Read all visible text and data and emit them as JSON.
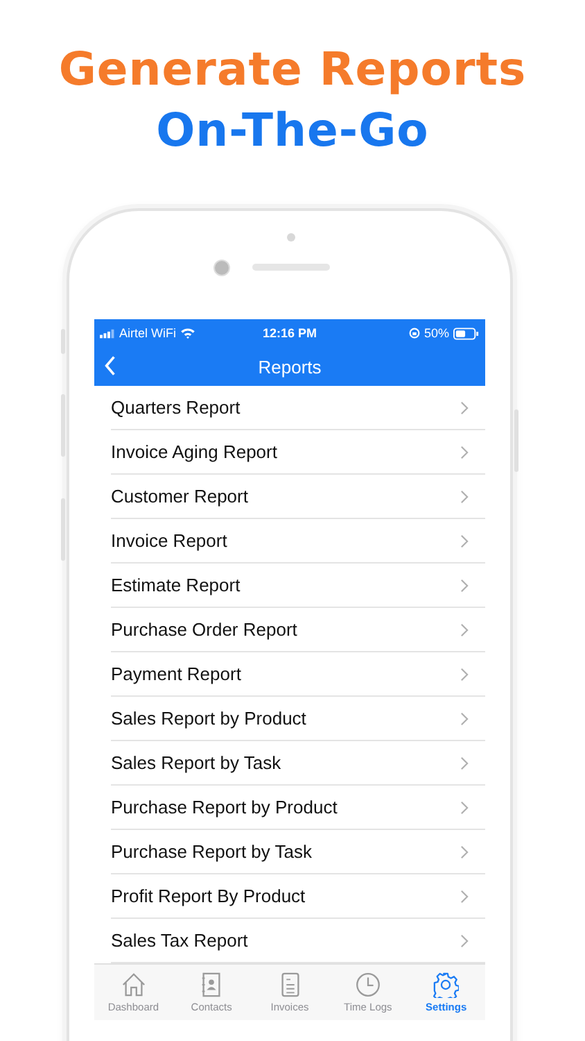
{
  "headline": {
    "line_1": "Generate Reports",
    "line_2": "On-The-Go"
  },
  "status_bar": {
    "carrier": "Airtel WiFi",
    "time": "12:16 PM",
    "battery": "50%"
  },
  "nav_bar": {
    "title": "Reports"
  },
  "reports": [
    {
      "label": "Quarters Report"
    },
    {
      "label": "Invoice Aging Report"
    },
    {
      "label": "Customer Report"
    },
    {
      "label": "Invoice Report"
    },
    {
      "label": "Estimate Report"
    },
    {
      "label": "Purchase Order Report"
    },
    {
      "label": "Payment Report"
    },
    {
      "label": "Sales Report by Product"
    },
    {
      "label": "Sales Report by Task"
    },
    {
      "label": "Purchase Report by Product"
    },
    {
      "label": "Purchase Report by Task"
    },
    {
      "label": "Profit Report By Product"
    },
    {
      "label": "Sales Tax Report"
    }
  ],
  "tab_bar": [
    {
      "label": "Dashboard",
      "kind": "house",
      "selected": false
    },
    {
      "label": "Contacts",
      "kind": "contacts",
      "selected": false
    },
    {
      "label": "Invoices",
      "kind": "document",
      "selected": false
    },
    {
      "label": "Time Logs",
      "kind": "clock",
      "selected": false
    },
    {
      "label": "Settings",
      "kind": "gear",
      "selected": true
    }
  ]
}
